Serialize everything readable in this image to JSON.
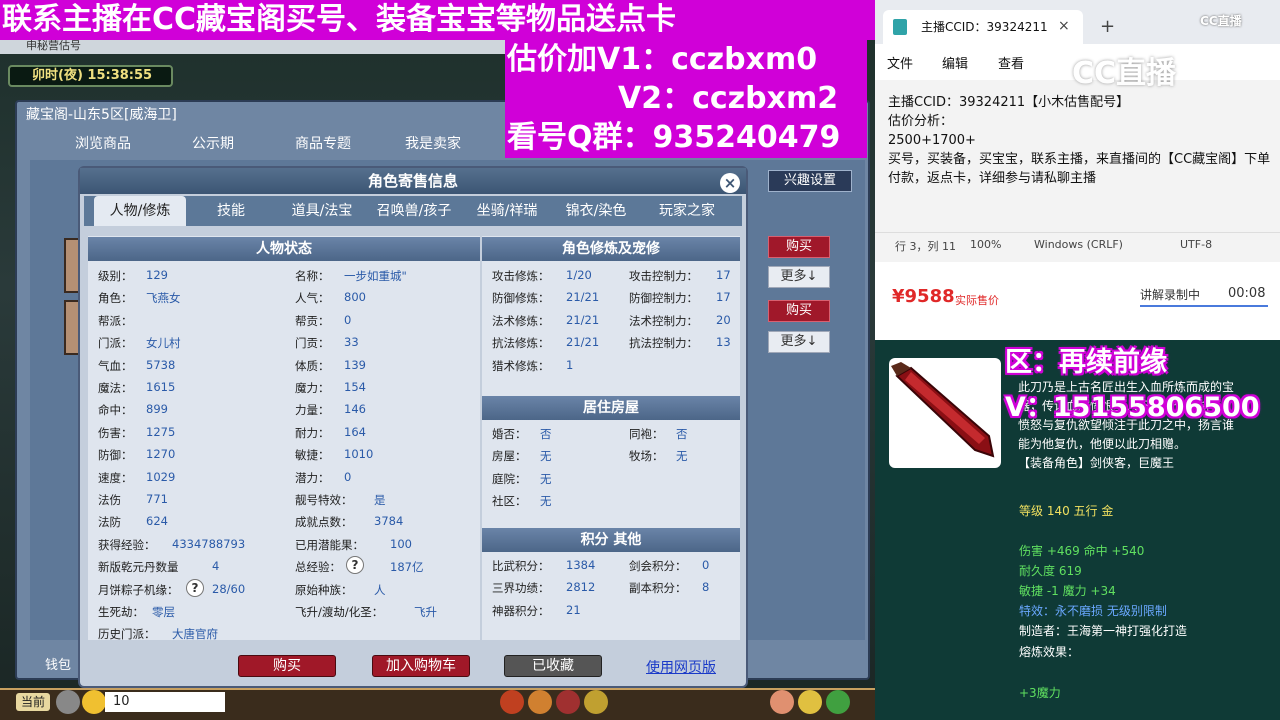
{
  "banner": {
    "top_line": "联系主播在CC藏宝阁买号、装备宝宝等物品送点卡",
    "promo_lines": [
      "估价加V1：cczbxm0",
      "V2：cczbxm2",
      "看号Q群：935240479"
    ]
  },
  "game": {
    "browser_tab": "申秘营估号",
    "time_label": "卯时(夜) 15:38:55",
    "store_title": "藏宝阁-山东5区[威海卫]",
    "store_tabs": [
      "浏览商品",
      "公示期",
      "商品专题",
      "我是卖家"
    ],
    "interest_btn": "兴趣设置",
    "side_buy": "购买",
    "side_more": "更多↓",
    "wallet_label": "钱包",
    "current_chip": "当前",
    "chat_count": "10"
  },
  "dialog": {
    "title": "角色寄售信息",
    "close": "×",
    "tabs": [
      "人物/修炼",
      "技能",
      "道具/法宝",
      "召唤兽/孩子",
      "坐骑/祥瑞",
      "锦衣/染色",
      "玩家之家"
    ],
    "status_header": "人物状态",
    "left_col": [
      {
        "k": "级别：",
        "v": "129"
      },
      {
        "k": "角色：",
        "v": "飞燕女"
      },
      {
        "k": "帮派：",
        "v": ""
      },
      {
        "k": "门派：",
        "v": "女儿村"
      },
      {
        "k": "气血：",
        "v": "5738"
      },
      {
        "k": "魔法：",
        "v": "1615"
      },
      {
        "k": "命中：",
        "v": "899"
      },
      {
        "k": "伤害：",
        "v": "1275"
      },
      {
        "k": "防御：",
        "v": "1270"
      },
      {
        "k": "速度：",
        "v": "1029"
      },
      {
        "k": "法伤",
        "v": "771"
      },
      {
        "k": "法防",
        "v": "624"
      },
      {
        "k": "获得经验：",
        "v": "4334788793"
      },
      {
        "k": "新版乾元丹数量",
        "v": "4"
      },
      {
        "k": "月饼粽子机缘：",
        "v": "28/60"
      },
      {
        "k": "生死劫：",
        "v": "零层"
      },
      {
        "k": "历史门派：",
        "v": "大唐官府"
      }
    ],
    "mid_col": [
      {
        "k": "名称：",
        "v": "一步如重城\""
      },
      {
        "k": "人气：",
        "v": "800"
      },
      {
        "k": "帮贡：",
        "v": "0"
      },
      {
        "k": "门贡：",
        "v": "33"
      },
      {
        "k": "体质：",
        "v": "139"
      },
      {
        "k": "魔力：",
        "v": "154"
      },
      {
        "k": "力量：",
        "v": "146"
      },
      {
        "k": "耐力：",
        "v": "164"
      },
      {
        "k": "敏捷：",
        "v": "1010"
      },
      {
        "k": "潜力：",
        "v": "0"
      },
      {
        "k": "靓号特效：",
        "v": "是"
      },
      {
        "k": "成就点数：",
        "v": "3784"
      },
      {
        "k": "已用潜能果：",
        "v": "100"
      },
      {
        "k": "总经验：",
        "v": "187亿"
      },
      {
        "k": "原始种族：",
        "v": "人"
      },
      {
        "k": "飞升/渡劫/化圣：",
        "v": "飞升"
      }
    ],
    "cult_header": "角色修炼及宠修",
    "cult_left": [
      {
        "k": "攻击修炼：",
        "v": "1/20"
      },
      {
        "k": "防御修炼：",
        "v": "21/21"
      },
      {
        "k": "法术修炼：",
        "v": "21/21"
      },
      {
        "k": "抗法修炼：",
        "v": "21/21"
      },
      {
        "k": "猎术修炼：",
        "v": "1"
      }
    ],
    "cult_right": [
      {
        "k": "攻击控制力：",
        "v": "17"
      },
      {
        "k": "防御控制力：",
        "v": "17"
      },
      {
        "k": "法术控制力：",
        "v": "20"
      },
      {
        "k": "抗法控制力：",
        "v": "13"
      }
    ],
    "house_header": "居住房屋",
    "house_left": [
      {
        "k": "婚否：",
        "v": "否"
      },
      {
        "k": "房屋：",
        "v": "无"
      },
      {
        "k": "庭院：",
        "v": "无"
      },
      {
        "k": "社区：",
        "v": "无"
      }
    ],
    "house_right": [
      {
        "k": "同袍：",
        "v": "否"
      },
      {
        "k": "牧场：",
        "v": "无"
      }
    ],
    "score_header": "积分 其他",
    "score_left": [
      {
        "k": "比武积分：",
        "v": "1384"
      },
      {
        "k": "三界功绩：",
        "v": "2812"
      },
      {
        "k": "神器积分：",
        "v": "21"
      }
    ],
    "score_right": [
      {
        "k": "剑会积分：",
        "v": "0"
      },
      {
        "k": "副本积分：",
        "v": "8"
      }
    ],
    "buy_btn": "购买",
    "cart_btn": "加入购物车",
    "fav_btn": "已收藏",
    "web_link": "使用网页版"
  },
  "notepad": {
    "tab_title": "主播CCID：39324211",
    "close": "×",
    "plus": "+",
    "menu": [
      "文件",
      "编辑",
      "查看"
    ],
    "lines": [
      "主播CCID：39324211【小木估售配号】",
      "估价分析：",
      "2500+1700+",
      "买号，买装备，买宝宝，联系主播，来直播间的【CC藏宝阁】下单付款，返点卡，详细参与请私聊主播"
    ],
    "status": [
      "行 3，列 11",
      "100%",
      "Windows (CRLF)",
      "UTF-8"
    ],
    "logo_big": "CC直播",
    "logo_small": "CC直播"
  },
  "price_card": {
    "price": "¥9588",
    "price_label": "实际售价",
    "rec_label": "讲解录制中",
    "rec_time": "00:08"
  },
  "item": {
    "overlay_qu": "区：再续前缘",
    "overlay_v": "V：15155806500",
    "desc_lines": [
      "此刀乃是上古名匠出生入血所炼而成的宝",
      "器，传说血魔愤恨主人不能报仇，将",
      "愤怒与复仇欲望倾注于此刀之中，扬言谁",
      "能为他复仇，他便以此刀相赠。",
      "【装备角色】剑侠客，巨魔王"
    ],
    "stats": [
      {
        "text": "等级 140 五行 金",
        "color": "#f0e060"
      },
      {
        "text": "伤害 +469 命中 +540",
        "color": "#60e060"
      },
      {
        "text": "耐久度 619",
        "color": "#60e060"
      },
      {
        "text": "敏捷 -1 魔力 +34",
        "color": "#60e060"
      },
      {
        "text": "特效：永不磨损 无级别限制",
        "color": "#6aa8ff"
      },
      {
        "text": "制造者：王海第一神打强化打造",
        "color": "#ffffff"
      },
      {
        "text": "熔炼效果：",
        "color": "#ffffff"
      },
      {
        "text": "+3魔力",
        "color": "#60e060"
      }
    ]
  },
  "colors": {
    "banner_magenta": "#d000d8",
    "buy_red": "#a01828",
    "price_red": "#e02828",
    "panel_teal": "#0f3a36"
  }
}
